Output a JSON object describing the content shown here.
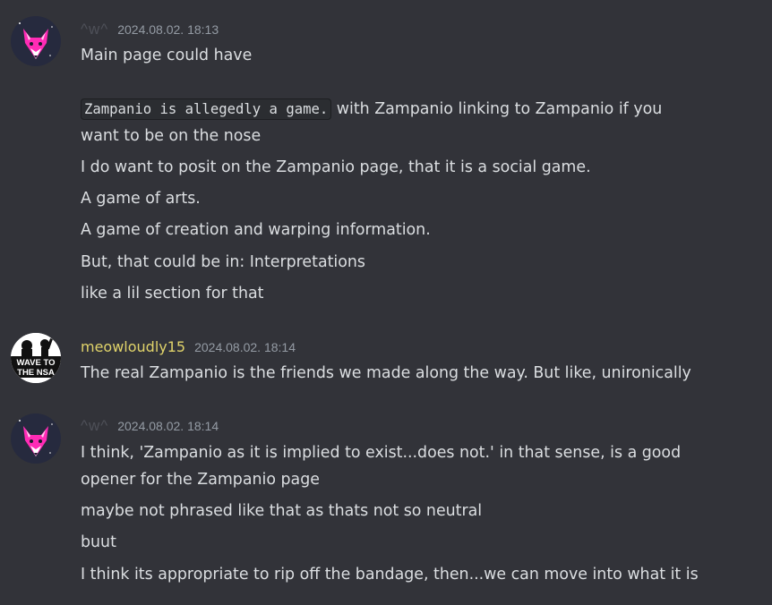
{
  "messages": [
    {
      "username": "^w^",
      "timestamp": "2024.08.02. 18:13",
      "code": "Zampanio is allegedly a game.",
      "lines": [
        "Main page could have",
        " with Zampanio linking to Zampanio if you",
        "want to be on the nose",
        "I do want to posit on the Zampanio page, that it is a social game.",
        "A game of arts.",
        "A game of creation and warping information.",
        "But, that could be in: Interpretations",
        "like a lil section for that"
      ]
    },
    {
      "username": "meowloudly15",
      "timestamp": "2024.08.02. 18:14",
      "avatar_text": [
        "WAVE TO",
        "THE NSA"
      ],
      "lines": [
        "The real Zampanio is the friends we made along the way. But like, unironically"
      ]
    },
    {
      "username": "^w^",
      "timestamp": "2024.08.02. 18:14",
      "lines": [
        "I think, 'Zampanio as it is implied to exist...does not.' in that sense, is a good",
        "opener for the Zampanio page",
        "maybe not phrased like that as thats not so neutral",
        "buut",
        "I think its appropriate to rip off the bandage, then...we can move into what it is"
      ]
    }
  ],
  "colors": {
    "background": "#323339",
    "text": "#dbdee1",
    "timestamp": "#949ba4",
    "username_muted": "#4e5058",
    "username_yellow": "#e0d36a",
    "fox_pink": "#ff2bb5"
  }
}
